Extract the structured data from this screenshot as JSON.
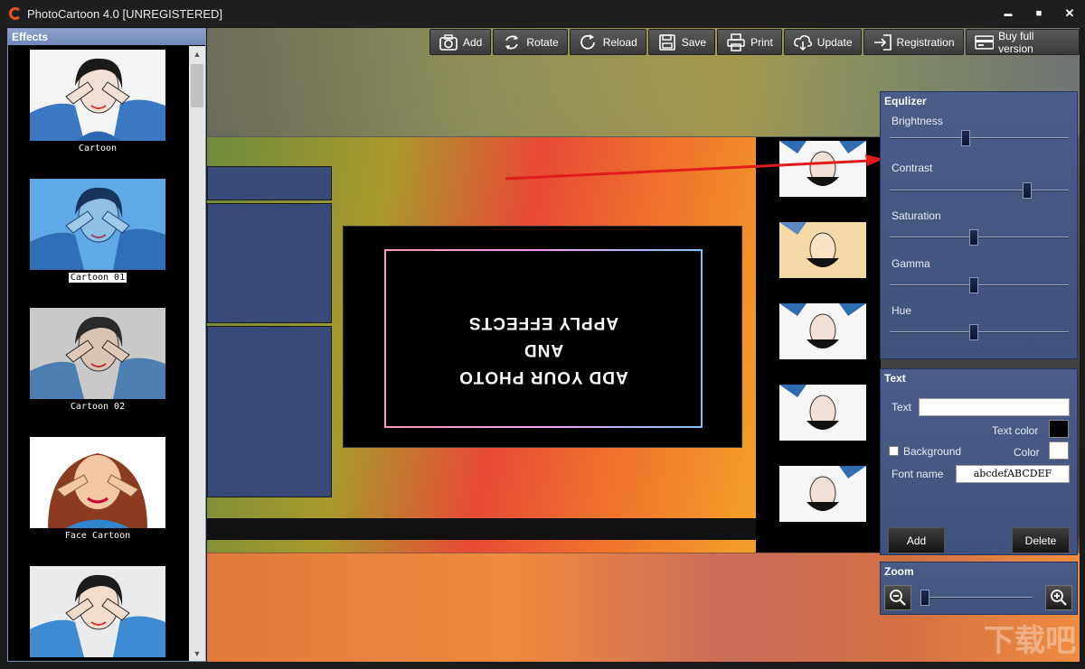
{
  "window": {
    "title": "PhotoCartoon 4.0 [UNREGISTERED]",
    "controls": {
      "minimize": "▬",
      "maximize": "■",
      "close": "✕"
    }
  },
  "effects": {
    "title": "Effects",
    "items": [
      {
        "label": "Cartoon",
        "selected": false
      },
      {
        "label": "Cartoon 01",
        "selected": true
      },
      {
        "label": "Cartoon 02",
        "selected": false
      },
      {
        "label": "Face Cartoon",
        "selected": false
      },
      {
        "label": "",
        "selected": false
      }
    ]
  },
  "toolbar": {
    "add": "Add",
    "rotate": "Rotate",
    "reload": "Reload",
    "save": "Save",
    "print": "Print",
    "update": "Update",
    "registration": "Registration",
    "buy": "Buy full version"
  },
  "preview": {
    "canvas_lines": [
      "ADD YOUR PHOTO",
      "AND",
      "APPLY EFFECTS"
    ]
  },
  "equalizer": {
    "title": "Equlizer",
    "sliders": [
      {
        "label": "Brightness",
        "value": 0.42
      },
      {
        "label": "Contrast",
        "value": 0.78
      },
      {
        "label": "Saturation",
        "value": 0.47
      },
      {
        "label": "Gamma",
        "value": 0.47
      },
      {
        "label": "Hue",
        "value": 0.47
      }
    ]
  },
  "text_panel": {
    "title": "Text",
    "text_label": "Text",
    "text_value": "",
    "text_color_label": "Text color",
    "text_color": "#000000",
    "background_label": "Background",
    "background_checked": false,
    "color_label": "Color",
    "color": "#ffffff",
    "font_name_label": "Font name",
    "font_preview": "abcdefABCDEF",
    "add_button": "Add",
    "delete_button": "Delete"
  },
  "zoom": {
    "title": "Zoom",
    "value": 0.0
  },
  "watermark": "下载吧",
  "colors": {
    "panel": "#475885",
    "accent_orange": "#e05a14",
    "arrow_red": "#e01c1c"
  }
}
